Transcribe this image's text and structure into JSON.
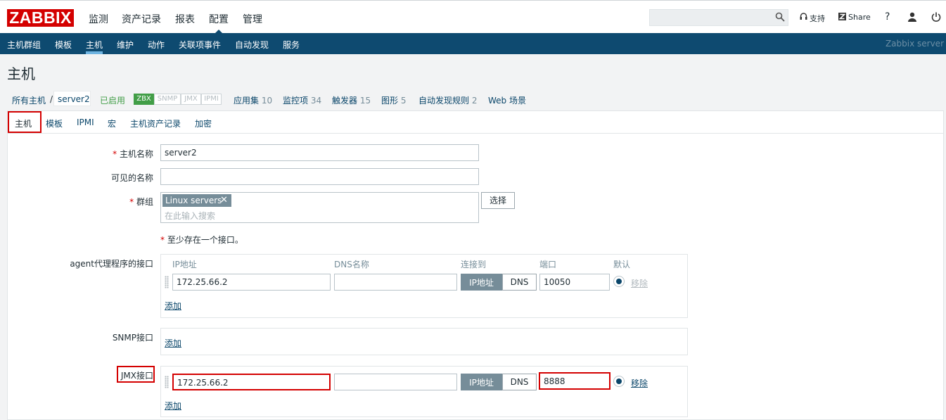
{
  "brand": {
    "logo": "ZABBIX"
  },
  "top_menu": [
    "监测",
    "资产记录",
    "报表",
    "配置",
    "管理"
  ],
  "top_right": {
    "support": "支持",
    "share": "Share",
    "help": "?"
  },
  "sub_menu": [
    "主机群组",
    "模板",
    "主机",
    "维护",
    "动作",
    "关联项事件",
    "自动发现",
    "服务"
  ],
  "server_name": "Zabbix server",
  "page_title": "主机",
  "breadcrumb": {
    "all_hosts": "所有主机",
    "sep": "/",
    "current": "server2",
    "status": "已启用",
    "badges": [
      "ZBX",
      "SNMP",
      "JMX",
      "IPMI"
    ],
    "links": [
      {
        "label": "应用集",
        "count": "10"
      },
      {
        "label": "监控项",
        "count": "34"
      },
      {
        "label": "触发器",
        "count": "15"
      },
      {
        "label": "图形",
        "count": "5"
      },
      {
        "label": "自动发现规则",
        "count": "2"
      },
      {
        "label": "Web 场景",
        "count": ""
      }
    ]
  },
  "tabs": [
    "主机",
    "模板",
    "IPMI",
    "宏",
    "主机资产记录",
    "加密"
  ],
  "form": {
    "required_mark": "*",
    "host_name_label": "主机名称",
    "host_name_value": "server2",
    "visible_name_label": "可见的名称",
    "visible_name_value": "",
    "groups_label": "群组",
    "group_tag": "Linux servers",
    "group_search_placeholder": "在此输入搜索",
    "select_button": "选择",
    "interface_note": "至少存在一个接口。",
    "agent_label": "agent代理程序的接口",
    "snmp_label": "SNMP接口",
    "jmx_label": "JMX接口",
    "columns": {
      "ip": "IP地址",
      "dns": "DNS名称",
      "connect": "连接到",
      "port": "端口",
      "default": "默认"
    },
    "agent": {
      "ip": "172.25.66.2",
      "dns": "",
      "port": "10050",
      "connect_ip": "IP地址",
      "connect_dns": "DNS",
      "remove": "移除"
    },
    "jmx": {
      "ip": "172.25.66.2",
      "dns": "",
      "port": "8888",
      "connect_ip": "IP地址",
      "connect_dns": "DNS",
      "remove": "移除"
    },
    "add": "添加"
  }
}
